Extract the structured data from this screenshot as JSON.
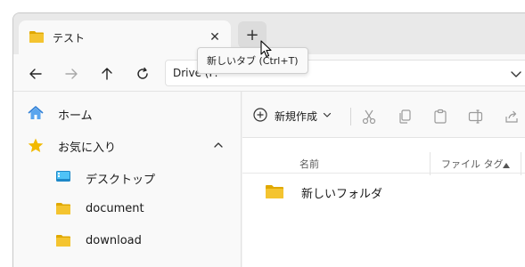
{
  "tab": {
    "title": "テスト",
    "close_glyph": "✕",
    "icon": "folder-icon"
  },
  "new_tab": {
    "glyph": "+"
  },
  "tooltip": {
    "text": "新しいタブ (Ctrl+T)"
  },
  "address": {
    "text": "Drive (F:"
  },
  "nav": {
    "back_icon": "arrow-left-icon",
    "forward_icon": "arrow-right-icon",
    "up_icon": "arrow-up-icon",
    "refresh_icon": "refresh-icon"
  },
  "sidebar": {
    "items": [
      {
        "label": "ホーム",
        "icon": "home-icon"
      },
      {
        "label": "お気に入り",
        "icon": "star-icon",
        "expanded": true
      },
      {
        "label": "デスクトップ",
        "icon": "desktop-icon"
      },
      {
        "label": "document",
        "icon": "folder-icon"
      },
      {
        "label": "download",
        "icon": "folder-icon"
      }
    ]
  },
  "toolbar": {
    "new_label": "新規作成"
  },
  "columns": {
    "name": "名前",
    "tags": "ファイル タグ"
  },
  "files": [
    {
      "name": "新しいフォルダ",
      "icon": "folder-icon"
    }
  ],
  "colors": {
    "folder": "#f4c430",
    "folder_dark": "#e0a800",
    "star": "#f2b900",
    "home": "#2f7fd6",
    "desktop": "#1e88c8"
  }
}
